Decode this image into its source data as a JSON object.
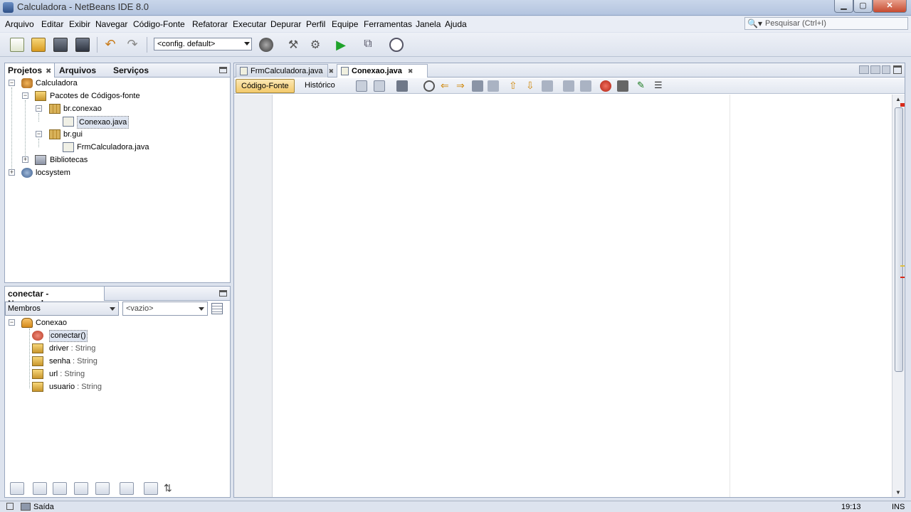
{
  "window": {
    "title": "Calculadora - NetBeans IDE 8.0"
  },
  "menu": [
    "Arquivo",
    "Editar",
    "Exibir",
    "Navegar",
    "Código-Fonte",
    "Refatorar",
    "Executar",
    "Depurar",
    "Perfil",
    "Equipe",
    "Ferramentas",
    "Janela",
    "Ajuda"
  ],
  "search": {
    "placeholder": "Pesquisar (Ctrl+I)"
  },
  "toolbar": {
    "config": "<config. default>"
  },
  "projects": {
    "tabs": [
      "Projetos",
      "Arquivos",
      "Serviços"
    ],
    "tree": [
      "Calculadora",
      "Pacotes de Códigos-fonte",
      "br.conexao",
      "Conexao.java",
      "br.gui",
      "FrmCalculadora.java",
      "Bibliotecas",
      "locsystem"
    ]
  },
  "navigator": {
    "title": "conectar - Navegador",
    "filter": "Membros",
    "empty": "<vazio>",
    "root": "Conexao",
    "items": [
      {
        "name": "conectar()",
        "type": ""
      },
      {
        "name": "driver",
        "type": " : String"
      },
      {
        "name": "senha",
        "type": " : String"
      },
      {
        "name": "url",
        "type": " : String"
      },
      {
        "name": "usuario",
        "type": " : String"
      }
    ]
  },
  "editor": {
    "tabs": [
      "FrmCalculadora.java",
      "Conexao.java"
    ],
    "source_label": "Código-Fonte",
    "history_label": "Histórico"
  },
  "status": {
    "output": "Saída",
    "position": "19:13",
    "mode": "INS"
  },
  "colors": {
    "keyword": "#0000e6",
    "string": "#ce7b00",
    "field": "#009900",
    "comment": "#808080"
  }
}
